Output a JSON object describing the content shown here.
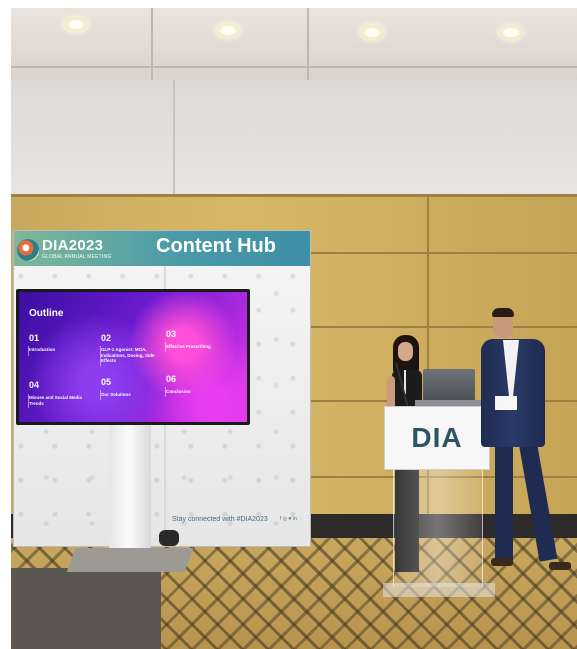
{
  "booth": {
    "brand": "DIA2023",
    "brand_sub": "GLOBAL ANNUAL MEETING",
    "title": "Content Hub",
    "footer": "Stay connected with #DIA2023",
    "social": "f ◎ ♥ in"
  },
  "screen": {
    "heading": "Outline",
    "items": [
      {
        "num": "01",
        "label": "Introduction"
      },
      {
        "num": "02",
        "label": "GLP-1 Agonist: MOA, Indications, Dosing, Side Effects"
      },
      {
        "num": "03",
        "label": "Effective Prescribing"
      },
      {
        "num": "04",
        "label": "Misuse and Social Media Trends"
      },
      {
        "num": "05",
        "label": "Our Solutions"
      },
      {
        "num": "06",
        "label": "Conclusion"
      }
    ]
  },
  "podium": {
    "logo": "DIA"
  }
}
